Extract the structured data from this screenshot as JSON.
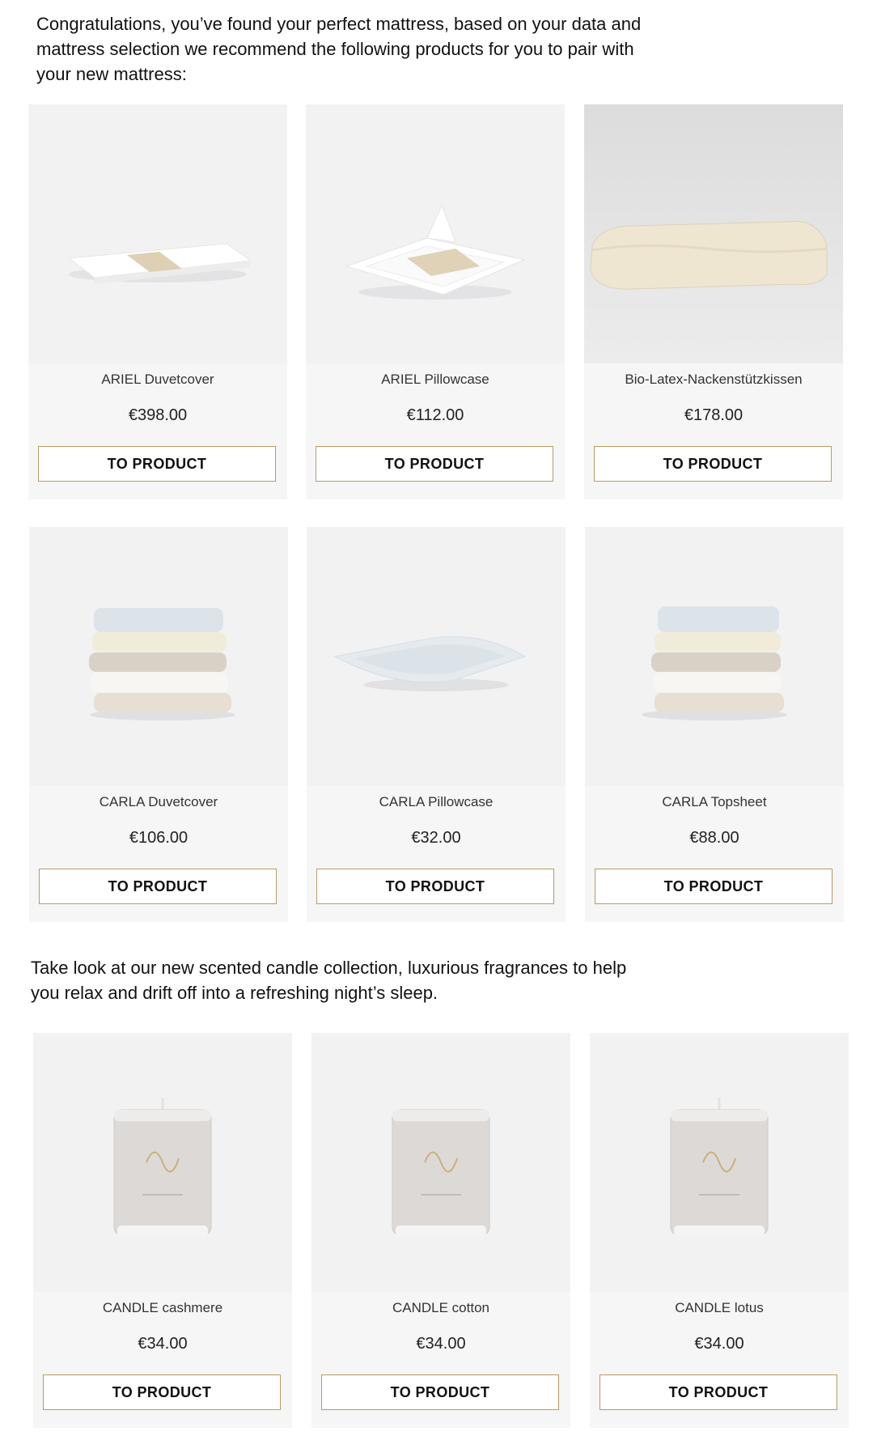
{
  "intro_text": "Congratulations, you’ve found your perfect mattress, based on your data and mattress selection we recommend the following products for you to pair with your new mattress:",
  "candle_intro_text": "Take look at our new scented candle collection, luxurious fragrances to help you relax and drift off into a refreshing night’s sleep.",
  "button_label": "TO PRODUCT",
  "accent_color": "#b79b63",
  "products": [
    {
      "name": "ARIEL Duvetcover",
      "price": "€398.00",
      "image": "folded-duvetcover-icon"
    },
    {
      "name": "ARIEL Pillowcase",
      "price": "€112.00",
      "image": "pillowcase-icon"
    },
    {
      "name": "Bio-Latex-Nackenstützkissen",
      "price": "€178.00",
      "image": "neck-pillow-icon"
    },
    {
      "name": "CARLA Duvetcover",
      "price": "€106.00",
      "image": "linen-stack-icon"
    },
    {
      "name": "CARLA Pillowcase",
      "price": "€32.00",
      "image": "pillowcase-icon"
    },
    {
      "name": "CARLA Topsheet",
      "price": "€88.00",
      "image": "linen-stack-icon"
    }
  ],
  "candles": [
    {
      "name": "CANDLE cashmere",
      "price": "€34.00",
      "image": "candle-jar-icon"
    },
    {
      "name": "CANDLE cotton",
      "price": "€34.00",
      "image": "candle-jar-icon"
    },
    {
      "name": "CANDLE lotus",
      "price": "€34.00",
      "image": "candle-jar-icon"
    }
  ]
}
